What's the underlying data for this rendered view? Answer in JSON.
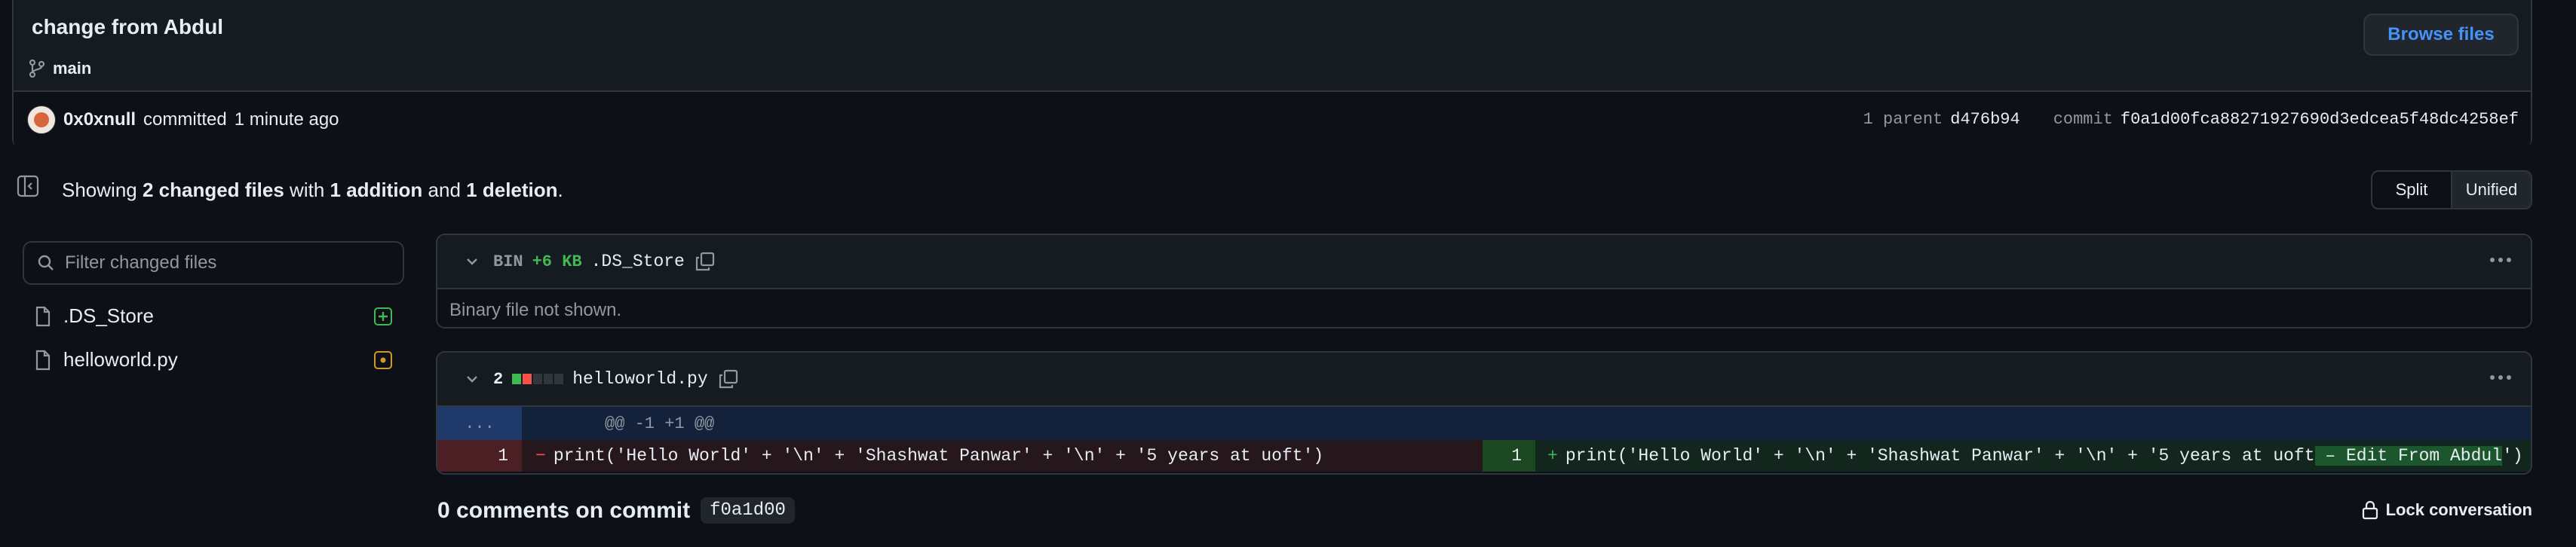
{
  "commit": {
    "title": "change from Abdul",
    "branch": "main",
    "browse_label": "Browse files",
    "author": "0x0xnull",
    "committed_text": "committed",
    "time_ago": "1 minute ago",
    "parent_label": "1 parent",
    "parent_sha": "d476b94",
    "commit_label": "commit",
    "commit_sha": "f0a1d00fca88271927690d3edcea5f48dc4258ef"
  },
  "summary": {
    "showing": "Showing",
    "changed_files": "2 changed files",
    "with": "with",
    "additions": "1 addition",
    "and": "and",
    "deletions": "1 deletion",
    "period": ".",
    "split_label": "Split",
    "unified_label": "Unified",
    "view_mode": "Unified"
  },
  "file_tree": {
    "filter_placeholder": "Filter changed files",
    "files": [
      {
        "name": ".DS_Store",
        "status": "added"
      },
      {
        "name": "helloworld.py",
        "status": "modified"
      }
    ]
  },
  "files": [
    {
      "kind_label": "BIN",
      "size_delta": "+6 KB",
      "name": ".DS_Store",
      "body": "Binary file not shown."
    },
    {
      "change_count": "2",
      "name": "helloworld.py",
      "hunk_expand": "...",
      "hunk_header": "@@ -1 +1 @@",
      "left_line_no": "1",
      "left_sign": "−",
      "left_code": "print('Hello World' + '\\n' + 'Shashwat Panwar' + '\\n' + '5 years at uoft')",
      "right_line_no": "1",
      "right_sign": "+",
      "right_code_before": "print('Hello World' + '\\n' + 'Shashwat Panwar' + '\\n' + '5 years at uoft",
      "right_code_added": " – Edit From Abdul",
      "right_code_after": "')"
    }
  ],
  "comments": {
    "count_title": "0 comments on commit",
    "sha": "f0a1d00",
    "lock_label": "Lock conversation"
  },
  "colors": {
    "background": "#0d1117",
    "accent_link": "#4493f8",
    "added": "#3fb950",
    "deleted": "#f85149",
    "modified": "#d29922"
  }
}
